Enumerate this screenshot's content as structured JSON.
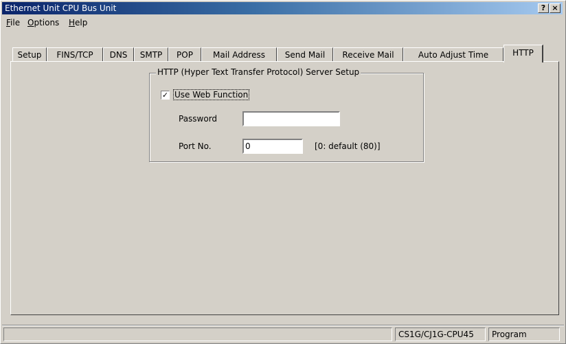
{
  "window": {
    "title": "Ethernet Unit CPU Bus Unit",
    "help_button": "?",
    "close_button": "×"
  },
  "menu": {
    "items": [
      {
        "first": "F",
        "rest": "ile"
      },
      {
        "first": "O",
        "rest": "ptions"
      },
      {
        "first": "H",
        "rest": "elp"
      }
    ]
  },
  "tabs": [
    {
      "label": "Setup"
    },
    {
      "label": "FINS/TCP"
    },
    {
      "label": "DNS"
    },
    {
      "label": "SMTP"
    },
    {
      "label": "POP"
    },
    {
      "label": "Mail Address"
    },
    {
      "label": "Send Mail"
    },
    {
      "label": "Receive Mail"
    },
    {
      "label": "Auto Adjust Time"
    },
    {
      "label": "HTTP"
    }
  ],
  "active_tab": "HTTP",
  "http": {
    "group_title": "HTTP (Hyper Text Transfer Protocol) Server Setup",
    "use_web_label": "Use Web Function",
    "use_web_checked": true,
    "password_label": "Password",
    "password_value": "",
    "port_label": "Port No.",
    "port_value": "0",
    "port_hint": "[0: default (80)]"
  },
  "status": {
    "model": "CS1G/CJ1G-CPU45",
    "mode": "Program"
  }
}
